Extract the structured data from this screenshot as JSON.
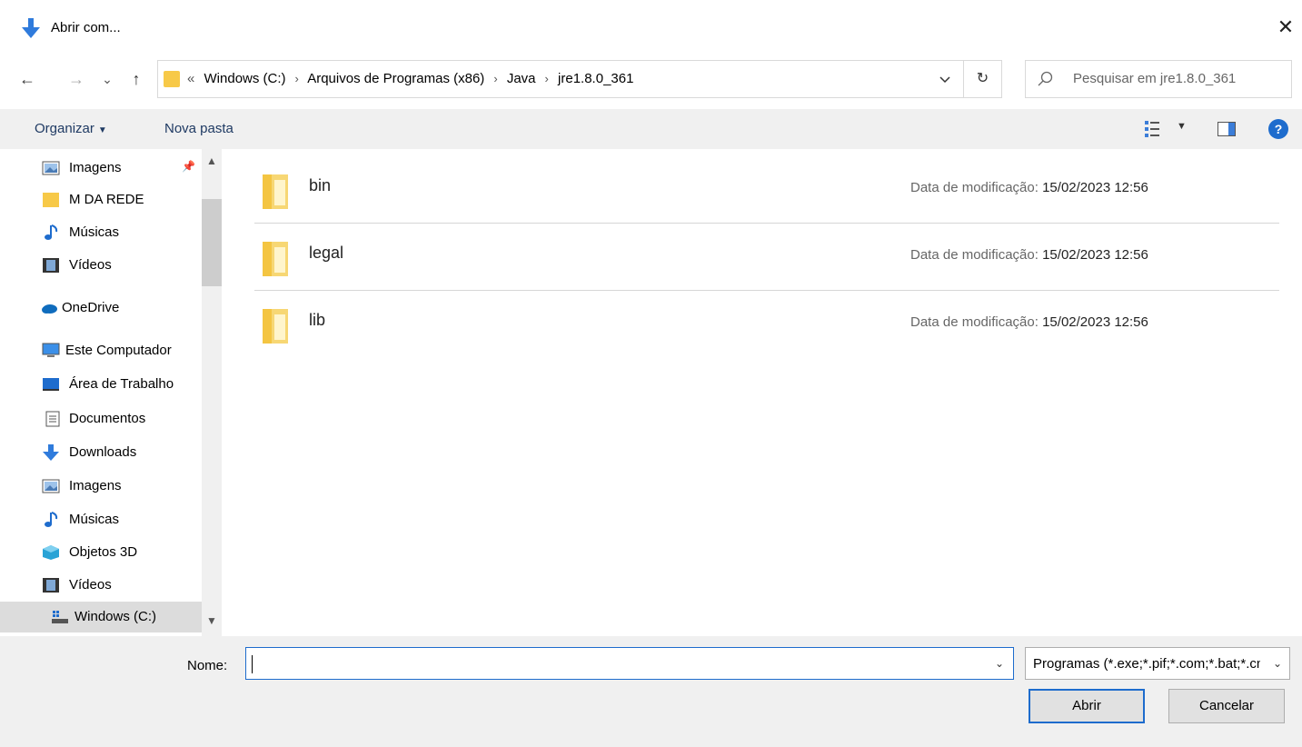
{
  "title": "Abrir com...",
  "close_label": "✕",
  "nav": {
    "back": "←",
    "forward": "→",
    "recent": "⌄",
    "up": "↑"
  },
  "address": {
    "overflow": "«",
    "crumbs": [
      "Windows (C:)",
      "Arquivos de Programas (x86)",
      "Java",
      "jre1.8.0_361"
    ],
    "separator": "›"
  },
  "search": {
    "placeholder": "Pesquisar em jre1.8.0_361"
  },
  "toolbar": {
    "organize": "Organizar",
    "organize_caret": "▼",
    "new_folder": "Nova pasta",
    "help": "?"
  },
  "sidebar": {
    "items": [
      {
        "label": "Imagens",
        "icon": "pictures-icon"
      },
      {
        "label": "M DA REDE",
        "icon": "folder-icon"
      },
      {
        "label": "Músicas",
        "icon": "music-icon"
      },
      {
        "label": "Vídeos",
        "icon": "videos-icon"
      },
      {
        "label": "OneDrive",
        "icon": "onedrive-icon"
      },
      {
        "label": "Este Computador",
        "icon": "computer-icon"
      },
      {
        "label": "Área de Trabalho",
        "icon": "desktop-icon"
      },
      {
        "label": "Documentos",
        "icon": "documents-icon"
      },
      {
        "label": "Downloads",
        "icon": "downloads-icon"
      },
      {
        "label": "Imagens",
        "icon": "pictures-icon"
      },
      {
        "label": "Músicas",
        "icon": "music-icon"
      },
      {
        "label": "Objetos 3D",
        "icon": "objects3d-icon"
      },
      {
        "label": "Vídeos",
        "icon": "videos-icon"
      },
      {
        "label": "Windows (C:)",
        "icon": "drive-icon"
      }
    ]
  },
  "files": [
    {
      "name": "bin",
      "meta_label": "Data de modificação:",
      "date": "15/02/2023 12:56"
    },
    {
      "name": "legal",
      "meta_label": "Data de modificação:",
      "date": "15/02/2023 12:56"
    },
    {
      "name": "lib",
      "meta_label": "Data de modificação:",
      "date": "15/02/2023 12:56"
    }
  ],
  "bottom": {
    "name_label": "Nome:",
    "name_value": "",
    "filter": "Programas (*.exe;*.pif;*.com;*.bat;*.cmd)",
    "open": "Abrir",
    "cancel": "Cancelar"
  },
  "colors": {
    "accent": "#1e6ccd",
    "folder": "#f7c948",
    "toolbar_bg": "#f0f0f0"
  }
}
